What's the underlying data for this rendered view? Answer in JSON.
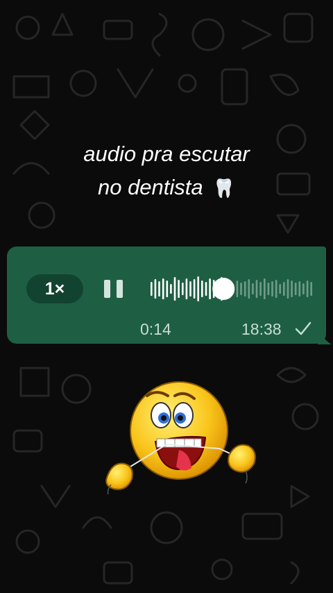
{
  "caption": {
    "line1": "audio pra escutar",
    "line2": "no dentista",
    "emoji": "🦷"
  },
  "voice_message": {
    "playback_speed": "1×",
    "elapsed_time": "0:14",
    "sent_time": "18:38",
    "playback_progress": 0.45,
    "state": "playing",
    "icons": {
      "control": "pause-icon",
      "read_receipt": "check-icon"
    }
  },
  "colors": {
    "bubble": "#1e5f44",
    "pill": "#124331",
    "wallpaper": "#0b0b0b",
    "doodle": "#262626",
    "text_muted": "#c7ddd3"
  },
  "sticker": "flossing-face-emoji"
}
